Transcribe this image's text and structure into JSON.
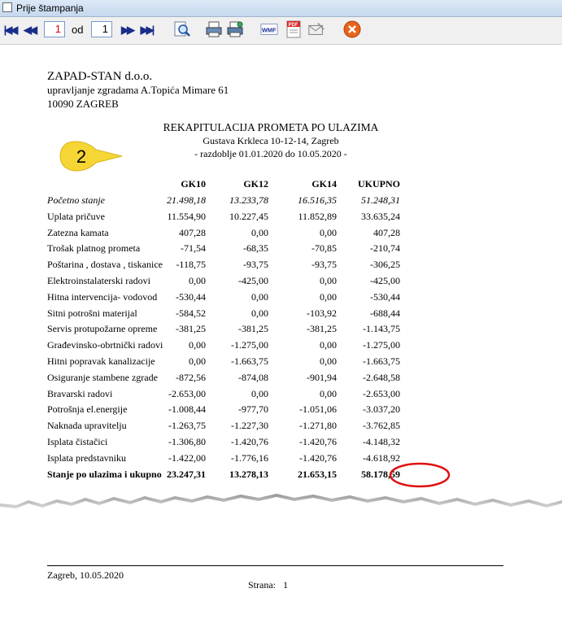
{
  "window": {
    "title": "Prije štampanja"
  },
  "toolbar": {
    "current_page": "1",
    "of_label": "od",
    "total_pages": "1"
  },
  "report": {
    "company": "ZAPAD-STAN d.o.o.",
    "address_line1": "upravljanje zgradama A.Topića Mimare 61",
    "address_line2": "10090 ZAGREB",
    "title": "REKAPITULACIJA PROMETA PO ULAZIMA",
    "subtitle": "Gustava Krkleca 10-12-14, Zagreb",
    "period": "- razdoblje 01.01.2020 do 10.05.2020 -",
    "badge": "2",
    "columns": [
      "GK10",
      "GK12",
      "GK14",
      "UKUPNO"
    ],
    "rows": [
      {
        "label": "Početno stanje",
        "values": [
          "21.498,18",
          "13.233,78",
          "16.516,35",
          "51.248,31"
        ]
      },
      {
        "label": "Uplata pričuve",
        "values": [
          "11.554,90",
          "10.227,45",
          "11.852,89",
          "33.635,24"
        ]
      },
      {
        "label": "Zatezna kamata",
        "values": [
          "407,28",
          "0,00",
          "0,00",
          "407,28"
        ]
      },
      {
        "label": "Trošak platnog prometa",
        "values": [
          "-71,54",
          "-68,35",
          "-70,85",
          "-210,74"
        ]
      },
      {
        "label": "Poštarina , dostava , tiskanice",
        "values": [
          "-118,75",
          "-93,75",
          "-93,75",
          "-306,25"
        ]
      },
      {
        "label": "Elektroinstalaterski radovi",
        "values": [
          "0,00",
          "-425,00",
          "0,00",
          "-425,00"
        ]
      },
      {
        "label": "Hitna intervencija- vodovod",
        "values": [
          "-530,44",
          "0,00",
          "0,00",
          "-530,44"
        ]
      },
      {
        "label": "Sitni potrošni materijal",
        "values": [
          "-584,52",
          "0,00",
          "-103,92",
          "-688,44"
        ]
      },
      {
        "label": "Servis protupožarne opreme",
        "values": [
          "-381,25",
          "-381,25",
          "-381,25",
          "-1.143,75"
        ]
      },
      {
        "label": "Građevinsko-obrtnički radovi",
        "values": [
          "0,00",
          "-1.275,00",
          "0,00",
          "-1.275,00"
        ]
      },
      {
        "label": "Hitni popravak kanalizacije",
        "values": [
          "0,00",
          "-1.663,75",
          "0,00",
          "-1.663,75"
        ]
      },
      {
        "label": "Osiguranje stambene zgrade",
        "values": [
          "-872,56",
          "-874,08",
          "-901,94",
          "-2.648,58"
        ]
      },
      {
        "label": "Bravarski radovi",
        "values": [
          "-2.653,00",
          "0,00",
          "0,00",
          "-2.653,00"
        ]
      },
      {
        "label": "Potrošnja el.energije",
        "values": [
          "-1.008,44",
          "-977,70",
          "-1.051,06",
          "-3.037,20"
        ]
      },
      {
        "label": "Naknada upravitelju",
        "values": [
          "-1.263,75",
          "-1.227,30",
          "-1.271,80",
          "-3.762,85"
        ]
      },
      {
        "label": "Isplata čistačici",
        "values": [
          "-1.306,80",
          "-1.420,76",
          "-1.420,76",
          "-4.148,32"
        ]
      },
      {
        "label": "Isplata predstavniku",
        "values": [
          "-1.422,00",
          "-1.776,16",
          "-1.420,76",
          "-4.618,92"
        ]
      }
    ],
    "total": {
      "label": "Stanje po ulazima i ukupno",
      "values": [
        "23.247,31",
        "13.278,13",
        "21.653,15",
        "58.178,59"
      ]
    }
  },
  "footer": {
    "date": "Zagreb, 10.05.2020",
    "page_label": "Strana:",
    "page_number": "1"
  },
  "colors": {
    "accent_circle": "#e01010",
    "badge_fill": "#f5d634",
    "nav_blue": "#1a2d8a",
    "close_orange": "#e8641c"
  }
}
